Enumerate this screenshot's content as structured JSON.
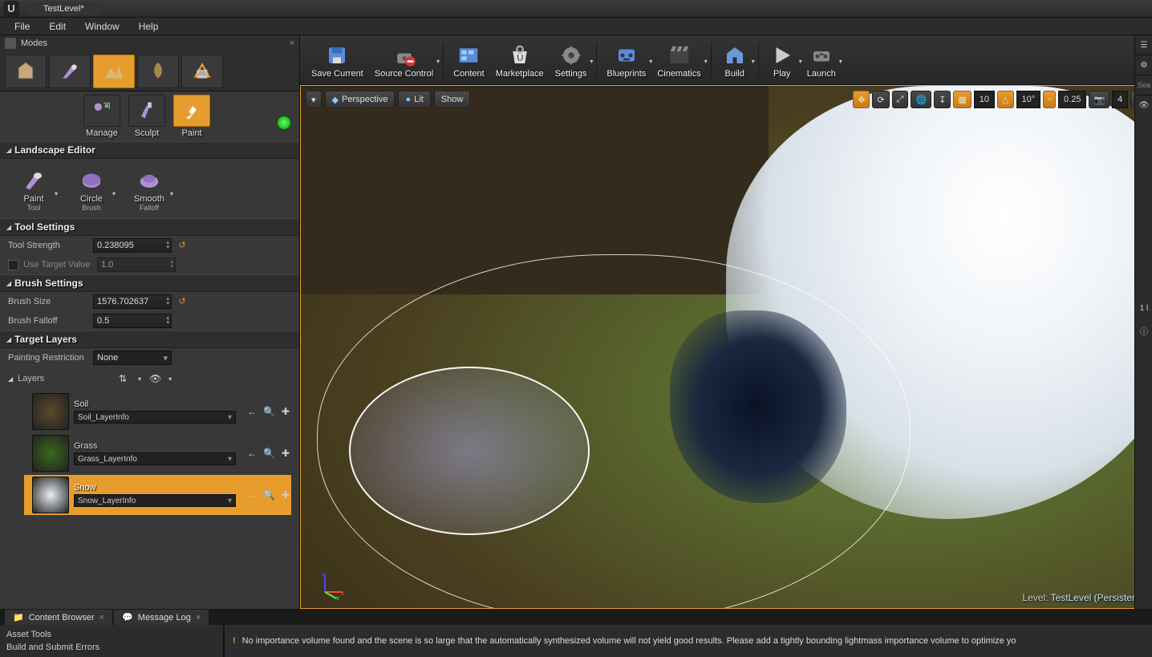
{
  "title": "TestLevel*",
  "menus": [
    "File",
    "Edit",
    "Window",
    "Help"
  ],
  "modesTab": "Modes",
  "landscapeModes": {
    "manage": "Manage",
    "sculpt": "Sculpt",
    "paint": "Paint"
  },
  "sections": {
    "landscapeEditor": "Landscape Editor",
    "toolSettings": "Tool Settings",
    "brushSettings": "Brush Settings",
    "targetLayers": "Target Layers"
  },
  "editorTools": {
    "paint": {
      "label": "Paint",
      "sub": "Tool"
    },
    "circle": {
      "label": "Circle",
      "sub": "Brush"
    },
    "smooth": {
      "label": "Smooth",
      "sub": "Falloff"
    }
  },
  "toolSettings": {
    "toolStrengthLabel": "Tool Strength",
    "toolStrengthValue": "0.238095",
    "useTargetValueLabel": "Use Target Value",
    "useTargetValueValue": "1.0"
  },
  "brushSettings": {
    "sizeLabel": "Brush Size",
    "sizeValue": "1576.702637",
    "falloffLabel": "Brush Falloff",
    "falloffValue": "0.5"
  },
  "targetLayers": {
    "restrictLabel": "Painting Restriction",
    "restrictValue": "None",
    "layersLabel": "Layers"
  },
  "layers": [
    {
      "name": "Soil",
      "info": "Soil_LayerInfo",
      "selected": false,
      "thumb": "#5a4a2a"
    },
    {
      "name": "Grass",
      "info": "Grass_LayerInfo",
      "selected": false,
      "thumb": "#3a6a1a"
    },
    {
      "name": "Snow",
      "info": "Snow_LayerInfo",
      "selected": true,
      "thumb": "#e8eef2"
    }
  ],
  "toolbar": [
    {
      "label": "Save Current",
      "arrow": false
    },
    {
      "label": "Source Control",
      "arrow": true,
      "warn": true
    },
    {
      "div": true
    },
    {
      "label": "Content",
      "arrow": false
    },
    {
      "label": "Marketplace",
      "arrow": false
    },
    {
      "label": "Settings",
      "arrow": true
    },
    {
      "div": true
    },
    {
      "label": "Blueprints",
      "arrow": true
    },
    {
      "label": "Cinematics",
      "arrow": true
    },
    {
      "div": true
    },
    {
      "label": "Build",
      "arrow": true
    },
    {
      "div": true
    },
    {
      "label": "Play",
      "arrow": true,
      "play": true
    },
    {
      "label": "Launch",
      "arrow": true
    }
  ],
  "viewport": {
    "perspective": "Perspective",
    "lit": "Lit",
    "show": "Show",
    "gridSnap": "10",
    "angleSnap": "10°",
    "scaleSnap": "0.25",
    "camSpeed": "4",
    "levelPrefix": "Level:",
    "levelName": "TestLevel (Persistent)"
  },
  "bottomTabs": {
    "content": "Content Browser",
    "msg": "Message Log"
  },
  "botLeft": [
    "Asset Tools",
    "Build and Submit Errors"
  ],
  "botMsg": "No importance volume found and the scene is so large that the automatically synthesized volume will not yield good results.  Please add a tightly bounding lightmass importance volume to optimize yo",
  "rightStrip": {
    "search": "Sea",
    "one": "1 l"
  }
}
